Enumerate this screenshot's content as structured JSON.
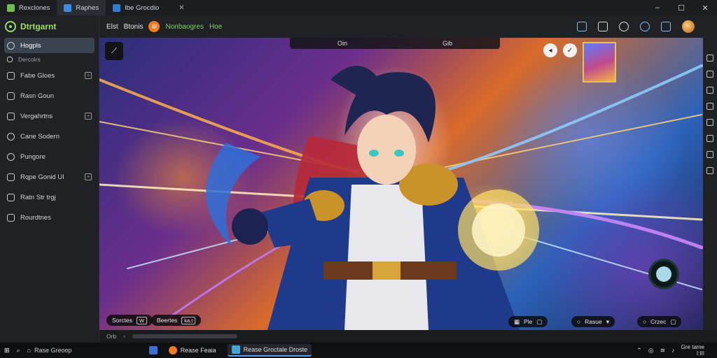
{
  "tabs": [
    {
      "label": "Rexclones",
      "active": false
    },
    {
      "label": "Raphes",
      "active": true
    },
    {
      "label": "Ibe Grocdio",
      "active": false
    }
  ],
  "window_controls": [
    "–",
    "☐",
    "✕"
  ],
  "brand": {
    "name": "Dtrtgarnt"
  },
  "sidebar": {
    "items": [
      {
        "label": "Hogpls",
        "active": true
      },
      {
        "label": "Dercolrs",
        "sub": true
      },
      {
        "label": "Fabe Gloes",
        "badge": "+"
      },
      {
        "label": "Rasn Goun"
      },
      {
        "label": "Vergahrtns",
        "badge": "+"
      },
      {
        "label": "Cane Sodern"
      },
      {
        "label": "Pungore"
      },
      {
        "label": "Rqpe Gonid UI",
        "badge": "+"
      },
      {
        "label": "Ratn Str trgj"
      },
      {
        "label": "Rourdtnes"
      }
    ]
  },
  "toolbar": {
    "crumb1": "Elst",
    "crumb2": "Btonis",
    "coin": "⚙",
    "crumb3": "Nonbaogres",
    "crumb4": "Hoe"
  },
  "viewport": {
    "banner_left": "Oin",
    "banner_right": "Gib",
    "pill_left_1": "Sorctes",
    "pill_left_1_chip": "W",
    "pill_left_2": "Beertes",
    "pill_left_2_chip": "ka.t",
    "pill_right_1": "Ple",
    "pill_right_2": "Rasue",
    "pill_right_3": "Crzec"
  },
  "strip": {
    "label": "Orb"
  },
  "taskbar": {
    "search": "Rase Greoop",
    "app1": "Rease Feaia",
    "app2": "Rease Groctale Droste"
  },
  "tray": {
    "line1": "Gre tame",
    "line2": "I:III"
  }
}
